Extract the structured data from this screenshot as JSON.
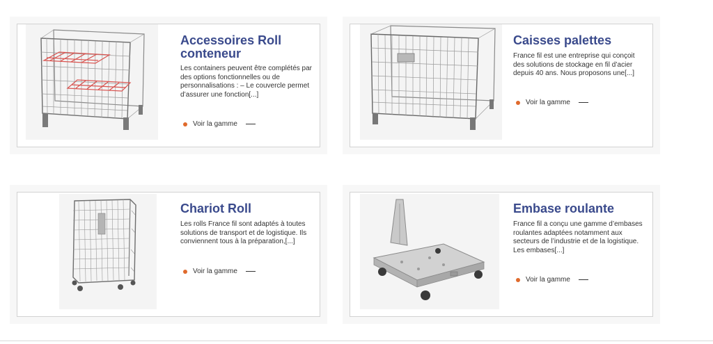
{
  "theme": {
    "title_color": "#3a4a8c",
    "accent": "#e06a2c",
    "text": "#333333"
  },
  "cards": [
    {
      "title": "Accessoires Roll conteneur",
      "description": "Les containers peuvent être complétés par des options fonctionnelles ou de personnalisations : – Le couvercle permet d’assurer une fonction[...]",
      "link_label": "Voir la gamme",
      "image_icon": "wire-container-with-red-shelves-icon"
    },
    {
      "title": "Caisses palettes",
      "description": "France fil est une entreprise qui conçoit des solutions de stockage en fil d’acier depuis 40 ans. Nous proposons une[...]",
      "link_label": "Voir la gamme",
      "image_icon": "wire-pallet-box-icon"
    },
    {
      "title": "Chariot Roll",
      "description": "Les rolls France fil sont adaptés à toutes solutions de transport et de logistique. Ils conviennent tous à la préparation,[...]",
      "link_label": "Voir la gamme",
      "image_icon": "roll-cage-trolley-icon"
    },
    {
      "title": "Embase roulante",
      "description": "France fil a conçu une gamme d’embases roulantes adaptées notamment aux secteurs de l’industrie et de la logistique. Les embases[...]",
      "link_label": "Voir la gamme",
      "image_icon": "rolling-base-platform-icon"
    }
  ]
}
